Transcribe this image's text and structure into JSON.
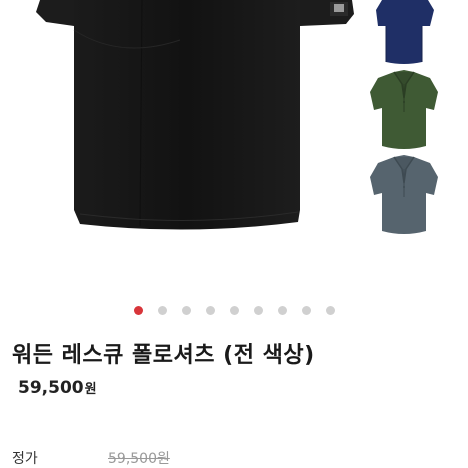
{
  "product": {
    "name": "워든 레스큐 폴로셔츠 (전 색상)",
    "sale_price": "59,500",
    "currency_unit": "원",
    "list_price_label": "정가",
    "list_price": "59,500원"
  },
  "gallery": {
    "main_color": "black",
    "swatches": [
      {
        "color_name": "navy",
        "hex": "#1f2f66"
      },
      {
        "color_name": "olive",
        "hex": "#3f5a34"
      },
      {
        "color_name": "grey",
        "hex": "#56646e"
      }
    ],
    "slide_count": 9,
    "active_slide": 1,
    "dot_active_color": "#d8353a",
    "dot_color": "#d0d0d0"
  }
}
